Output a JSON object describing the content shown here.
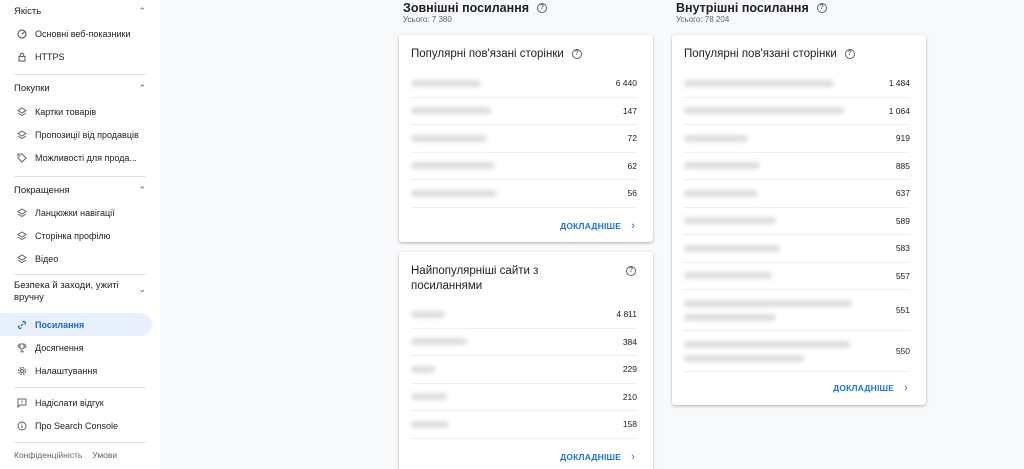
{
  "sidebar": {
    "sections": [
      {
        "title": "Якість",
        "items": [
          "Основні веб-показники",
          "HTTPS"
        ]
      },
      {
        "title": "Покупки",
        "items": [
          "Картки товарів",
          "Пропозиції від продавців",
          "Можливості для прода..."
        ]
      },
      {
        "title": "Покращення",
        "items": [
          "Ланцюжки навігації",
          "Сторінка профілю",
          "Відео"
        ]
      },
      {
        "title": "Безпека й заходи, ужиті вручну"
      }
    ],
    "nav": [
      "Посилання",
      "Досягнення",
      "Налаштування"
    ],
    "extra": [
      "Надіслати відгук",
      "Про Search Console"
    ],
    "footer": [
      "Конфіденційність",
      "Умови"
    ]
  },
  "external": {
    "title": "Зовнішні посилання",
    "total": "Усього: 7 380",
    "top_pages": {
      "title": "Популярні пов'язані сторінки",
      "values": [
        "6 440",
        "147",
        "72",
        "62",
        "56"
      ],
      "more": "ДОКЛАДНІШЕ"
    },
    "top_sites": {
      "title": "Найпопулярніші сайти з посиланнями",
      "values": [
        "4 811",
        "384",
        "229",
        "210",
        "158"
      ],
      "more": "ДОКЛАДНІШЕ"
    }
  },
  "internal": {
    "title": "Внутрішні посилання",
    "total": "Усього: 78 204",
    "top_pages": {
      "title": "Популярні пов'язані сторінки",
      "values": [
        "1 484",
        "1 064",
        "919",
        "885",
        "637",
        "589",
        "583",
        "557",
        "551",
        "550"
      ],
      "more": "ДОКЛАДНІШЕ"
    }
  }
}
